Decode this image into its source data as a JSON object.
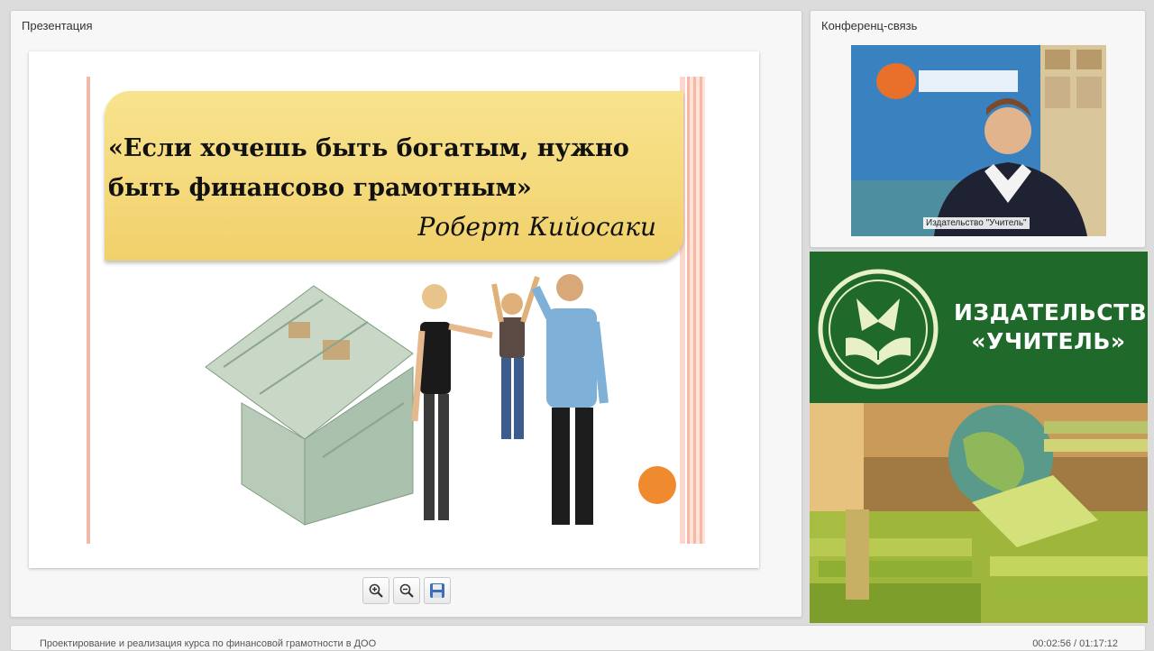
{
  "presentation": {
    "title": "Презентация",
    "slide": {
      "quote": "«Если хочешь быть богатым, нужно быть финансово грамотным»",
      "author": "Роберт Кийосаки"
    },
    "toolbar": {
      "zoom_in_icon": "zoom-in-icon",
      "zoom_out_icon": "zoom-out-icon",
      "save_icon": "save-icon"
    }
  },
  "conference": {
    "title": "Конференц-связь",
    "video_label": "Издательство \"Учитель\""
  },
  "banner": {
    "name_line1": "ИЗДАТЕЛЬСТВО",
    "name_line2": "«УЧИТЕЛЬ»"
  },
  "footer": {
    "course_title": "Проектирование и реализация курса по финансовой грамотности в ДОО",
    "time": "00:02:56 / 01:17:12"
  },
  "colors": {
    "quote_box": "#f4d97a",
    "banner_green": "#1f6a2b",
    "accent_orange": "#f08a2e"
  }
}
